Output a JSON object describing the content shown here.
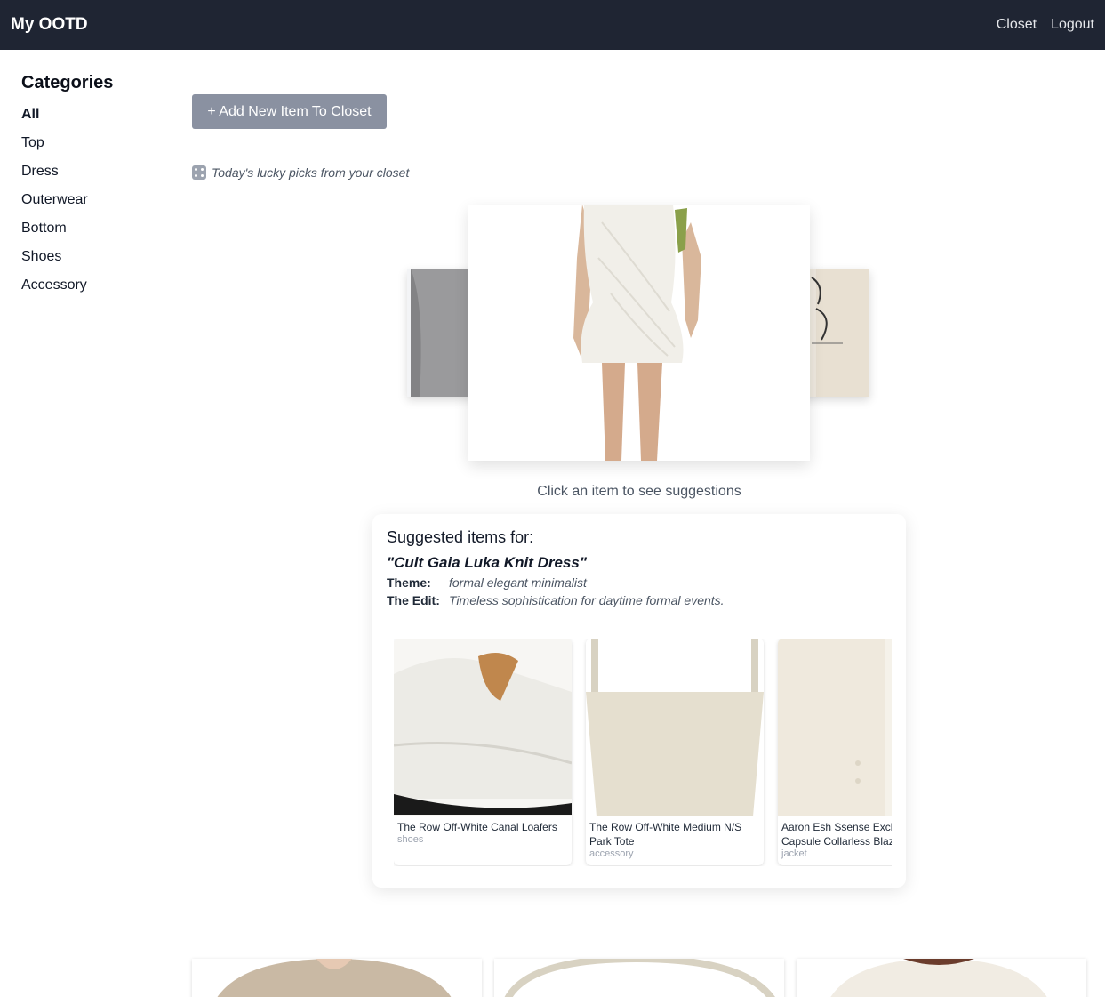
{
  "navbar": {
    "brand": "My OOTD",
    "links": [
      "Closet",
      "Logout"
    ]
  },
  "sidebar": {
    "title": "Categories",
    "items": [
      "All",
      "Top",
      "Dress",
      "Outerwear",
      "Bottom",
      "Shoes",
      "Accessory"
    ],
    "active": "All"
  },
  "actions": {
    "add_item_label": "+ Add New Item To Closet"
  },
  "lucky": {
    "text": "Today's lucky picks from your closet",
    "icon": "dice-icon"
  },
  "carousel": {
    "hint": "Click an item to see suggestions"
  },
  "suggestions": {
    "heading": "Suggested items for:",
    "item_name": "\"Cult Gaia Luka Knit Dress\"",
    "theme_label": "Theme:",
    "theme_value": "formal elegant minimalist",
    "edit_label": "The Edit:",
    "edit_value": "Timeless sophistication for daytime formal events.",
    "items": [
      {
        "name": "The Row Off-White Canal Loafers",
        "category": "shoes"
      },
      {
        "name": "The Row Off-White Medium N/S Park Tote",
        "category": "accessory"
      },
      {
        "name": "Aaron Esh Ssense Exclusive Capsule Collarless Blazer",
        "category": "jacket"
      }
    ]
  },
  "colors": {
    "navbar_bg": "#1f2533",
    "button_bg": "#8a91a1"
  }
}
